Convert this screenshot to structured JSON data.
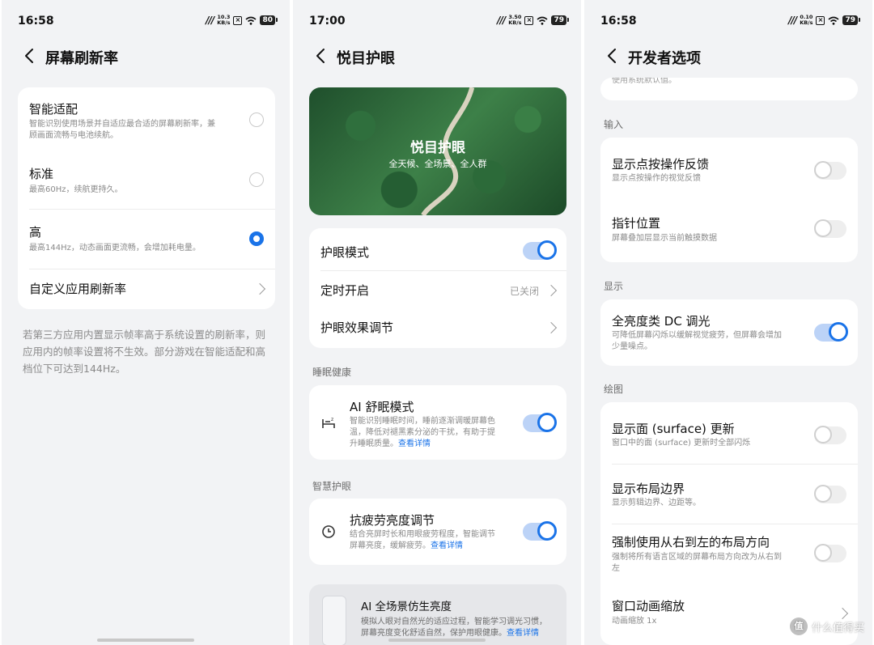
{
  "panel1": {
    "status": {
      "time": "16:58",
      "net": [
        "10.3",
        "KB/s"
      ],
      "battery": "80"
    },
    "title": "屏幕刷新率",
    "options": [
      {
        "title": "智能适配",
        "desc": [
          "智能识别使用场景并自适应最合适的屏幕刷新率，兼",
          "顾画面流畅与电池续航。"
        ],
        "selected": false
      },
      {
        "title": "标准",
        "desc": [
          "最高60Hz，续航更持久。"
        ],
        "selected": false
      },
      {
        "title": "高",
        "desc": [
          "最高144Hz，动态画面更流畅，会增加耗电量。"
        ],
        "selected": true
      }
    ],
    "custom_label": "自定义应用刷新率",
    "note": [
      "若第三方应用内置显示帧率高于系统设置的刷新率，则",
      "应用内的帧率设置将不生效。部分游戏在智能适配和高",
      "档位下可达到144Hz。"
    ]
  },
  "panel2": {
    "status": {
      "time": "17:00",
      "net": [
        "3.50",
        "KB/s"
      ],
      "battery": "79"
    },
    "title": "悦目护眼",
    "hero": {
      "title": "悦目护眼",
      "subtitle": "全天候、全场景、全人群"
    },
    "rows": {
      "eye_mode": {
        "label": "护眼模式",
        "on": true
      },
      "schedule": {
        "label": "定时开启",
        "value": "已关闭"
      },
      "effect": {
        "label": "护眼效果调节"
      }
    },
    "section_sleep": "睡眠健康",
    "sleep": {
      "title": "AI 舒眠模式",
      "desc": [
        "智能识别睡眠时间，睡前逐渐调暖屏幕色",
        "温，降低对褪黑素分泌的干扰，有助于提",
        "升睡眠质量。"
      ],
      "link": "查看详情",
      "on": true
    },
    "section_smart": "智慧护眼",
    "anti": {
      "title": "抗疲劳亮度调节",
      "desc": [
        "结合亮屏时长和用眼疲劳程度，智能调节",
        "屏幕亮度，缓解疲劳。"
      ],
      "link": "查看详情",
      "on": true
    },
    "ai_card": {
      "title": "AI 全场景仿生亮度",
      "desc": [
        "模拟人眼对自然光的适应过程，智能学习调光习惯，",
        "屏幕亮度变化舒适自然，保护用眼健康。"
      ],
      "link": "查看详情"
    }
  },
  "panel3": {
    "status": {
      "time": "16:58",
      "net": [
        "0.10",
        "KB/s"
      ],
      "battery": "79"
    },
    "title": "开发者选项",
    "top_partial": "使用系统默认值。",
    "section_input": "输入",
    "input_rows": [
      {
        "title": "显示点按操作反馈",
        "desc": "显示点按操作的视觉反馈",
        "on": false
      },
      {
        "title": "指针位置",
        "desc": "屏幕叠加层显示当前触摸数据",
        "on": false
      }
    ],
    "section_display": "显示",
    "dc": {
      "title": "全亮度类 DC 调光",
      "desc": [
        "可降低屏幕闪烁以缓解视觉疲劳，但屏幕会增加",
        "少量噪点。"
      ],
      "on": true
    },
    "section_draw": "绘图",
    "draw_rows": [
      {
        "title": "显示面 (surface) 更新",
        "desc": [
          "窗口中的面 (surface) 更新时全部闪烁"
        ],
        "on": false
      },
      {
        "title": "显示布局边界",
        "desc": [
          "显示剪辑边界、边距等。"
        ],
        "on": false
      },
      {
        "title": "强制使用从右到左的布局方向",
        "desc": [
          "强制将所有语言区域的屏幕布局方向改为从右到",
          "左"
        ],
        "on": false
      }
    ],
    "anim": {
      "title": "窗口动画缩放",
      "value": "动画缩放 1x"
    },
    "watermark": {
      "badge": "值",
      "text": "什么值得买"
    }
  }
}
